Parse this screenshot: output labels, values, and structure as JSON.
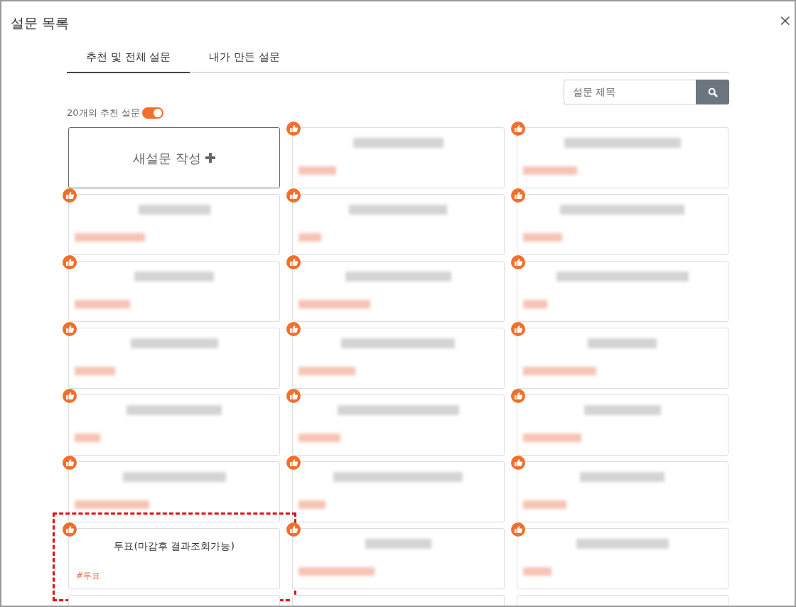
{
  "dialog": {
    "title": "설문 목록",
    "close": "×"
  },
  "tabs": [
    {
      "label": "추천 및 전체 설문",
      "selected": true
    },
    {
      "label": "내가 만든 설문",
      "selected": false
    }
  ],
  "search": {
    "placeholder": "설문 제목"
  },
  "recommend_toggle": {
    "label": "20개의 추천 설문",
    "on": true
  },
  "cards": [
    {
      "kind": "new",
      "label": "새설문 작성",
      "recommended": false
    },
    {
      "kind": "redacted",
      "recommended": true
    },
    {
      "kind": "redacted",
      "recommended": true
    },
    {
      "kind": "redacted",
      "recommended": true
    },
    {
      "kind": "redacted",
      "recommended": true
    },
    {
      "kind": "redacted",
      "recommended": true
    },
    {
      "kind": "redacted",
      "recommended": true
    },
    {
      "kind": "redacted",
      "recommended": true
    },
    {
      "kind": "redacted",
      "recommended": true
    },
    {
      "kind": "redacted",
      "recommended": true
    },
    {
      "kind": "redacted",
      "recommended": true
    },
    {
      "kind": "redacted",
      "recommended": true
    },
    {
      "kind": "redacted",
      "recommended": true
    },
    {
      "kind": "redacted",
      "recommended": true
    },
    {
      "kind": "redacted",
      "recommended": true
    },
    {
      "kind": "redacted",
      "recommended": true
    },
    {
      "kind": "redacted",
      "recommended": true
    },
    {
      "kind": "redacted",
      "recommended": true
    },
    {
      "kind": "survey",
      "title": "투표(마감후 결과조회가능)",
      "tag": "#투표",
      "recommended": true,
      "highlighted": true
    },
    {
      "kind": "redacted",
      "recommended": true
    },
    {
      "kind": "redacted",
      "recommended": true
    },
    {
      "kind": "edge",
      "recommended": false
    },
    {
      "kind": "edge",
      "recommended": false
    },
    {
      "kind": "edge",
      "recommended": false
    }
  ]
}
